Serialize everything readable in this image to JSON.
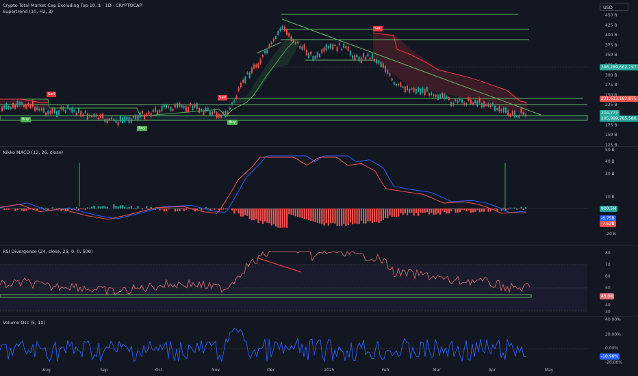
{
  "header": {
    "title": "Crypto Total Market Cap Excluding Top 10, $ · 1D · CRYPTOCAP",
    "indicator": "Supertrend (10, H2, 3)",
    "currency": "USD"
  },
  "price_axis": [
    "450 B",
    "425 B",
    "400 B",
    "375 B",
    "350 B",
    "325 B",
    "300 B",
    "275 B",
    "250 B",
    "225 B",
    "200 B",
    "175 B",
    "150 B",
    "125 B"
  ],
  "price_badges": {
    "upper": "308,289,662,297.80",
    "mid": "231,613,162,875.32",
    "last": "204,773",
    "low": "205,999,765,586.75"
  },
  "signals": {
    "sell": "Sell",
    "buy": "Buy"
  },
  "macd": {
    "title": "Nikko MACD (12, 26, close)",
    "axis": [
      "50 B",
      "40 B",
      "30 B",
      "10 B",
      "-20 B"
    ],
    "values": [
      "900.5M",
      "-6.75B",
      "-7.63B"
    ]
  },
  "rsi": {
    "title": "RSI Divergence (24, close, 25, 0, 0, 500)",
    "axis": [
      "80",
      "70",
      "60",
      "50",
      "40",
      "30"
    ],
    "value": "45.38"
  },
  "volume": {
    "title": "Volume Osc (5, 10)",
    "axis": [
      "40.00%",
      "20.00%",
      "0.00%",
      "-20.00%"
    ],
    "value": "-10.96%"
  },
  "time_axis": [
    "Aug",
    "Sep",
    "Oct",
    "Nov",
    "Dec",
    "2025",
    "Feb",
    "Mar",
    "Apr",
    "May"
  ],
  "colors": {
    "background": "#131722",
    "up": "#26a69a",
    "down": "#ef5350",
    "supertrend_up": "#4caf50",
    "supertrend_down": "#f23645",
    "trendline": "#66bb6a",
    "rsi": "#e57373",
    "volume": "#2962ff"
  }
}
